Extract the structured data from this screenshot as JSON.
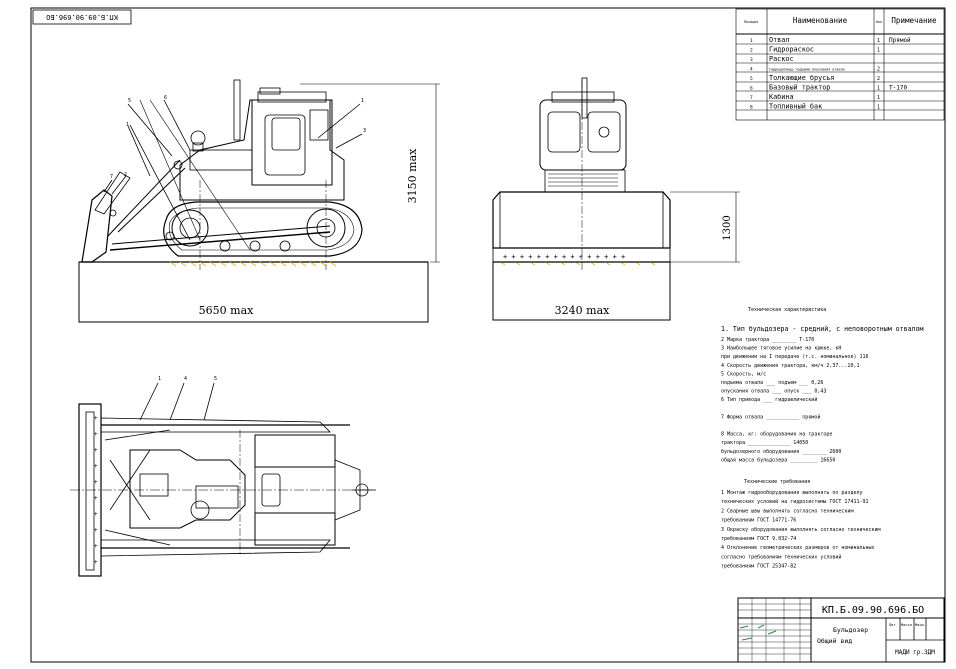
{
  "corner_stamp": "КП.Б.09.90.696.БО",
  "dimensions": {
    "side_length": "5650 max",
    "side_height": "3150 max",
    "front_width": "3240 max",
    "front_blade_height": "1300"
  },
  "callouts": {
    "side_view": [
      "5",
      "6",
      "1",
      "3",
      "1",
      "2",
      "7"
    ],
    "plan_view": [
      "1",
      "4",
      "5"
    ]
  },
  "parts_table": {
    "headers": [
      "Позиция",
      "Наименование",
      "Кол",
      "Примечание"
    ],
    "rows": [
      {
        "pos": "1",
        "name": "Отвал",
        "qty": "1",
        "note": "Прямой"
      },
      {
        "pos": "2",
        "name": "Гидрораскос",
        "qty": "1",
        "note": ""
      },
      {
        "pos": "3",
        "name": "Раскос",
        "qty": "",
        "note": ""
      },
      {
        "pos": "4",
        "name": "Гидроцилиндр подъема-опускания отвала",
        "qty": "2",
        "note": ""
      },
      {
        "pos": "5",
        "name": "Толкающие брусья",
        "qty": "2",
        "note": ""
      },
      {
        "pos": "6",
        "name": "Базовый трактор",
        "qty": "1",
        "note": "Т-170"
      },
      {
        "pos": "7",
        "name": "Кабина",
        "qty": "1",
        "note": ""
      },
      {
        "pos": "8",
        "name": "Топливный бак",
        "qty": "1",
        "note": ""
      }
    ]
  },
  "specs": {
    "heading": "Техническая характеристика",
    "main": "1. Тип бульдозера - средний, с неповоротным отвалом",
    "lines": [
      "2 Марка трактора ________ Т-170",
      "3 Наибольшее тяговое усилие на крюке, кН",
      "при движении на I передаче (т.с. номинальное) 116",
      "4 Скорость движения трактора, км/ч 2,37...10,1",
      "5 Скорость, м/с",
      "подъема отвала ___ подъем ___ 0,26",
      "опускания отвала ___ опуск ___ 0,43",
      "6 Тип привода ___ гидравлический",
      "",
      "7 Форма отвала ___________ прямой",
      "",
      "8 Масса, кг: оборудования на тракторе",
      "тракторa ______________ 14050",
      "бульдозерного оборудования ________ 2600",
      "общая масса бульдозера _________ 16650"
    ],
    "req_heading": "Технические требования",
    "req_lines": [
      "1 Монтаж гидрооборудования выполнять по разделу",
      "технических условий на гидросистемы ГОСТ 17411-91",
      "2 Сварные швы выполнять согласно техническим",
      "требованиям ГОСТ 14771-76",
      "3 Окраску оборудования выполнять согласно техническим",
      "требованиям ГОСТ 9.032-74",
      "4 Отклонение геометрических размеров от номинальных",
      "согласно требованиям технических условий",
      "требованиям ГОСТ 25347-82"
    ]
  },
  "title_block": {
    "doc_number": "КП.Б.09.90.696.БО",
    "name": "Бульдозер",
    "subname": "Общий вид",
    "sheet": "Лит",
    "mass": "Масса",
    "scale": "Масш.",
    "org": "МАДИ гр.ЗДМ"
  }
}
